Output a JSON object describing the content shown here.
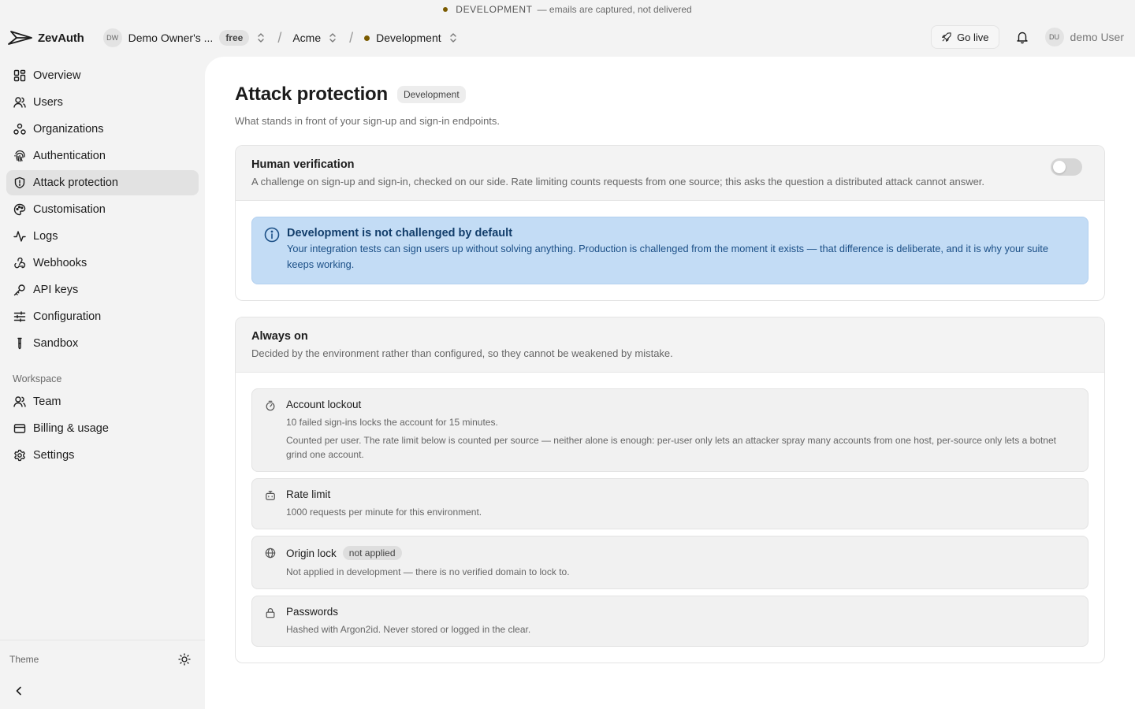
{
  "banner": {
    "env": "DEVELOPMENT",
    "note": "— emails are captured, not delivered"
  },
  "topbar": {
    "logo_text": "ZevAuth",
    "workspace_initials": "DW",
    "workspace_name": "Demo Owner's ...",
    "plan": "free",
    "project": "Acme",
    "environment": "Development",
    "go_live": "Go live",
    "user_initials": "DU",
    "user_name": "demo User"
  },
  "sidebar": {
    "items": [
      {
        "label": "Overview",
        "icon": "grid-icon"
      },
      {
        "label": "Users",
        "icon": "user-icon"
      },
      {
        "label": "Organizations",
        "icon": "organizations-icon"
      },
      {
        "label": "Authentication",
        "icon": "fingerprint-icon"
      },
      {
        "label": "Attack protection",
        "icon": "shield-icon",
        "active": true
      },
      {
        "label": "Customisation",
        "icon": "palette-icon"
      },
      {
        "label": "Logs",
        "icon": "activity-icon"
      },
      {
        "label": "Webhooks",
        "icon": "webhook-icon"
      },
      {
        "label": "API keys",
        "icon": "key-icon"
      },
      {
        "label": "Configuration",
        "icon": "sliders-icon"
      },
      {
        "label": "Sandbox",
        "icon": "test-tube-icon"
      }
    ],
    "workspace_label": "Workspace",
    "workspace_items": [
      {
        "label": "Team",
        "icon": "user-icon"
      },
      {
        "label": "Billing & usage",
        "icon": "credit-card-icon"
      },
      {
        "label": "Settings",
        "icon": "gear-icon"
      }
    ],
    "theme_label": "Theme"
  },
  "page": {
    "title": "Attack protection",
    "env_badge": "Development",
    "subtitle": "What stands in front of your sign-up and sign-in endpoints."
  },
  "human_verification": {
    "title": "Human verification",
    "description": "A challenge on sign-up and sign-in, checked on our side. Rate limiting counts requests from one source; this asks the question a distributed attack cannot answer.",
    "enabled": false,
    "info_title": "Development is not challenged by default",
    "info_text": "Your integration tests can sign users up without solving anything. Production is challenged from the moment it exists — that difference is deliberate, and it is why your suite keeps working."
  },
  "always_on": {
    "title": "Always on",
    "description": "Decided by the environment rather than configured, so they cannot be weakened by mistake.",
    "lockout": {
      "title": "Account lockout",
      "line1": "10 failed sign-ins locks the account for 15 minutes.",
      "line2": "Counted per user. The rate limit below is counted per source — neither alone is enough: per-user only lets an attacker spray many accounts from one host, per-source only lets a botnet grind one account."
    },
    "rate_limit": {
      "title": "Rate limit",
      "line1": "1000 requests per minute for this environment."
    },
    "origin_lock": {
      "title": "Origin lock",
      "badge": "not applied",
      "line1": "Not applied in development — there is no verified domain to lock to."
    },
    "passwords": {
      "title": "Passwords",
      "line1": "Hashed with Argon2id. Never stored or logged in the clear."
    }
  }
}
